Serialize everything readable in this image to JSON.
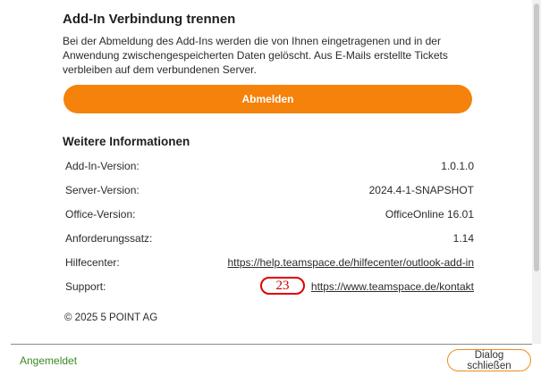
{
  "disconnect": {
    "title": "Add-In Verbindung trennen",
    "description": "Bei der Abmeldung des Add-Ins werden die von Ihnen eingetragenen und in der Anwendung zwischengespeicherten Daten gelöscht. Aus E-Mails erstellte Tickets verbleiben auf dem verbundenen Server.",
    "button_label": "Abmelden"
  },
  "info": {
    "title": "Weitere Informationen",
    "rows": [
      {
        "label": "Add-In-Version:",
        "value": "1.0.1.0"
      },
      {
        "label": "Server-Version:",
        "value": "2024.4-1-SNAPSHOT"
      },
      {
        "label": "Office-Version:",
        "value": "OfficeOnline 16.01"
      },
      {
        "label": "Anforderungssatz:",
        "value": "1.14"
      },
      {
        "label": "Hilfecenter:",
        "value": "https://help.teamspace.de/hilfecenter/outlook-add-in"
      },
      {
        "label": "Support:",
        "value": "https://www.teamspace.de/kontakt"
      }
    ]
  },
  "annotation_badge": "23",
  "copyright": "© 2025 5 POINT AG",
  "footer": {
    "status": "Angemeldet",
    "close_label": "Dialog schließen"
  },
  "colors": {
    "accent": "#f5820b",
    "status_green": "#3a8a22",
    "annotation_red": "#e00000"
  }
}
